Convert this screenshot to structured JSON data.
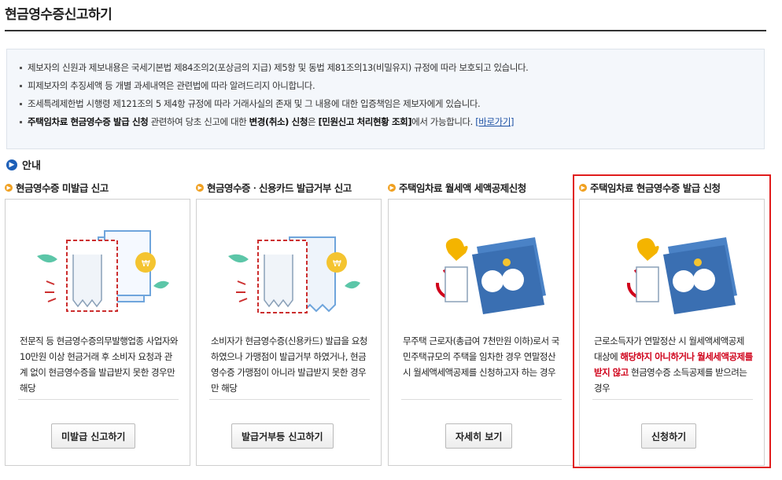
{
  "page": {
    "title": "현금영수증신고하기"
  },
  "notice": {
    "line1": "제보자의 신원과 제보내용은 국세기본법 제84조의2(포상금의 지급) 제5항 및 동법 제81조의13(비밀유지) 규정에 따라 보호되고 있습니다.",
    "line2": "피제보자의 추징세액 등 개별 과세내역은 관련법에 따라 알려드리지 아니합니다.",
    "line3": "조세특례제한법 시행령 제121조의 5 제4항 규정에 따라 거래사실의 존재 및 그 내용에 대한 입증책임은 제보자에게 있습니다.",
    "line4_b1": "주택임차료 현금영수증 발급 신청",
    "line4_t1": " 관련하여 당초 신고에 대한 ",
    "line4_b2": "변경(취소) 신청",
    "line4_t2": "은 ",
    "line4_b3": "[민원신고 처리현황 조회]",
    "line4_t3": "에서 가능합니다. ",
    "line4_link": "[바로가기]"
  },
  "guide": {
    "title": "안내"
  },
  "cards": [
    {
      "title": "현금영수증 미발급 신고",
      "desc": "전문직 등 현금영수증의무발행업종 사업자와 10만원 이상 현금거래 후 소비자 요청과 관계 없이 현금영수증을 발급받지 못한 경우만 해당",
      "button": "미발급 신고하기"
    },
    {
      "title": "현금영수증ㆍ신용카드 발급거부 신고",
      "desc": "소비자가 현금영수증(신용카드) 발급을 요청하였으나 가맹점이 발급거부 하였거나, 현금영수증 가맹점이 아니라 발급받지 못한 경우만 해당",
      "button": "발급거부등 신고하기"
    },
    {
      "title": "주택임차료 월세액 세액공제신청",
      "desc": "무주택 근로자(총급여 7천만원 이하)로서 국민주택규모의 주택을 임차한 경우 연말정산시 월세액세액공제를 신청하고자 하는 경우",
      "button": "자세히 보기"
    },
    {
      "title": "주택임차료 현금영수증 발급 신청",
      "desc_a": "근로소득자가 연말정산 시 월세액세액공제 대상에 ",
      "desc_red": "해당하지 아니하거나 월세세액공제를 받지 않고",
      "desc_b": " 현금영수증 소득공제를 받으려는 경우",
      "button": "신청하기"
    }
  ],
  "colors": {
    "accent_blue": "#1d5fb8",
    "highlight_red": "#e01c1c",
    "bullet_orange": "#f0a020"
  }
}
